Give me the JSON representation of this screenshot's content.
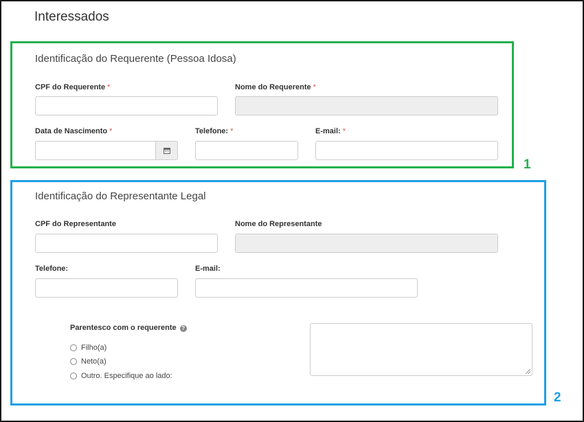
{
  "page": {
    "title": "Interessados"
  },
  "requerente": {
    "number": "1",
    "title": "Identificação do Requerente (Pessoa Idosa)",
    "cpf_label": "CPF do Requerente",
    "cpf_value": "",
    "nome_label": "Nome do Requerente",
    "nome_value": "",
    "nascimento_label": "Data de Nascimento",
    "nascimento_value": "",
    "telefone_label": "Telefone:",
    "telefone_value": "",
    "email_label": "E-mail:",
    "email_value": "",
    "required_mark": "*"
  },
  "representante": {
    "number": "2",
    "title": "Identificação do Representante Legal",
    "cpf_label": "CPF do Representante",
    "cpf_value": "",
    "nome_label": "Nome do Representante",
    "nome_value": "",
    "telefone_label": "Telefone:",
    "telefone_value": "",
    "email_label": "E-mail:",
    "email_value": "",
    "parentesco_label": "Parentesco com o requerente",
    "parentesco_options": [
      "Filho(a)",
      "Neto(a)",
      "Outro. Especifique ao lado:"
    ],
    "especificar_value": ""
  },
  "icons": {
    "calendar": "calendar-icon",
    "help": "question-circle-icon"
  },
  "colors": {
    "box1_border": "#22b14c",
    "box2_border": "#1ea0e6",
    "required": "#e05050"
  }
}
